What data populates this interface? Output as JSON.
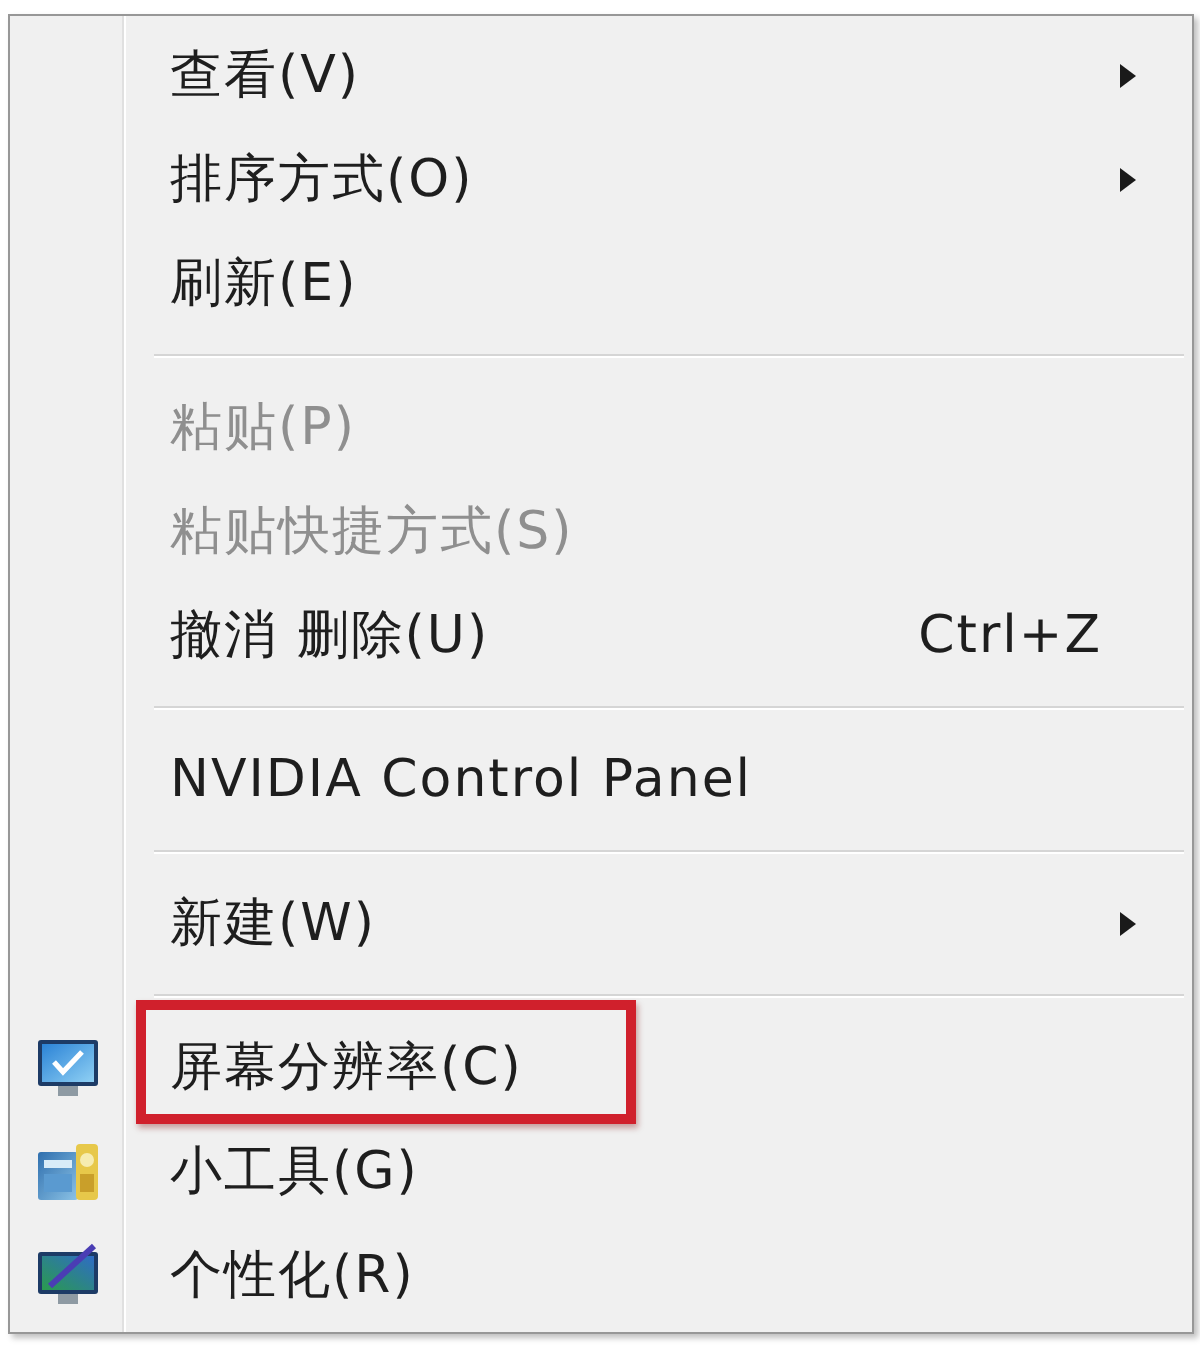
{
  "menu": {
    "items": [
      {
        "kind": "item",
        "label": "查看(V)",
        "disabled": false,
        "submenu": true,
        "outlined": false
      },
      {
        "kind": "item",
        "label": "排序方式(O)",
        "disabled": false,
        "submenu": true,
        "outlined": false
      },
      {
        "kind": "item",
        "label": "刷新(E)",
        "disabled": false,
        "submenu": false,
        "outlined": false
      },
      {
        "kind": "separator"
      },
      {
        "kind": "item",
        "label": "粘贴(P)",
        "disabled": true,
        "submenu": false,
        "outlined": false
      },
      {
        "kind": "item",
        "label": "粘贴快捷方式(S)",
        "disabled": true,
        "submenu": false,
        "outlined": false
      },
      {
        "kind": "item",
        "label": "撤消 删除(U)",
        "shortcut": "Ctrl+Z",
        "disabled": false,
        "submenu": false,
        "outlined": false
      },
      {
        "kind": "separator"
      },
      {
        "kind": "item",
        "label": "NVIDIA Control Panel",
        "disabled": false,
        "submenu": false,
        "outlined": false
      },
      {
        "kind": "separator"
      },
      {
        "kind": "item",
        "label": "新建(W)",
        "disabled": false,
        "submenu": true,
        "outlined": false
      },
      {
        "kind": "separator"
      },
      {
        "kind": "display",
        "label": "屏幕分辨率(C)",
        "disabled": false,
        "submenu": false,
        "outlined": true
      },
      {
        "kind": "gadgets",
        "label": "小工具(G)",
        "disabled": false,
        "submenu": false,
        "outlined": false
      },
      {
        "kind": "personalize",
        "label": "个性化(R)",
        "disabled": false,
        "submenu": false,
        "outlined": false
      }
    ]
  }
}
